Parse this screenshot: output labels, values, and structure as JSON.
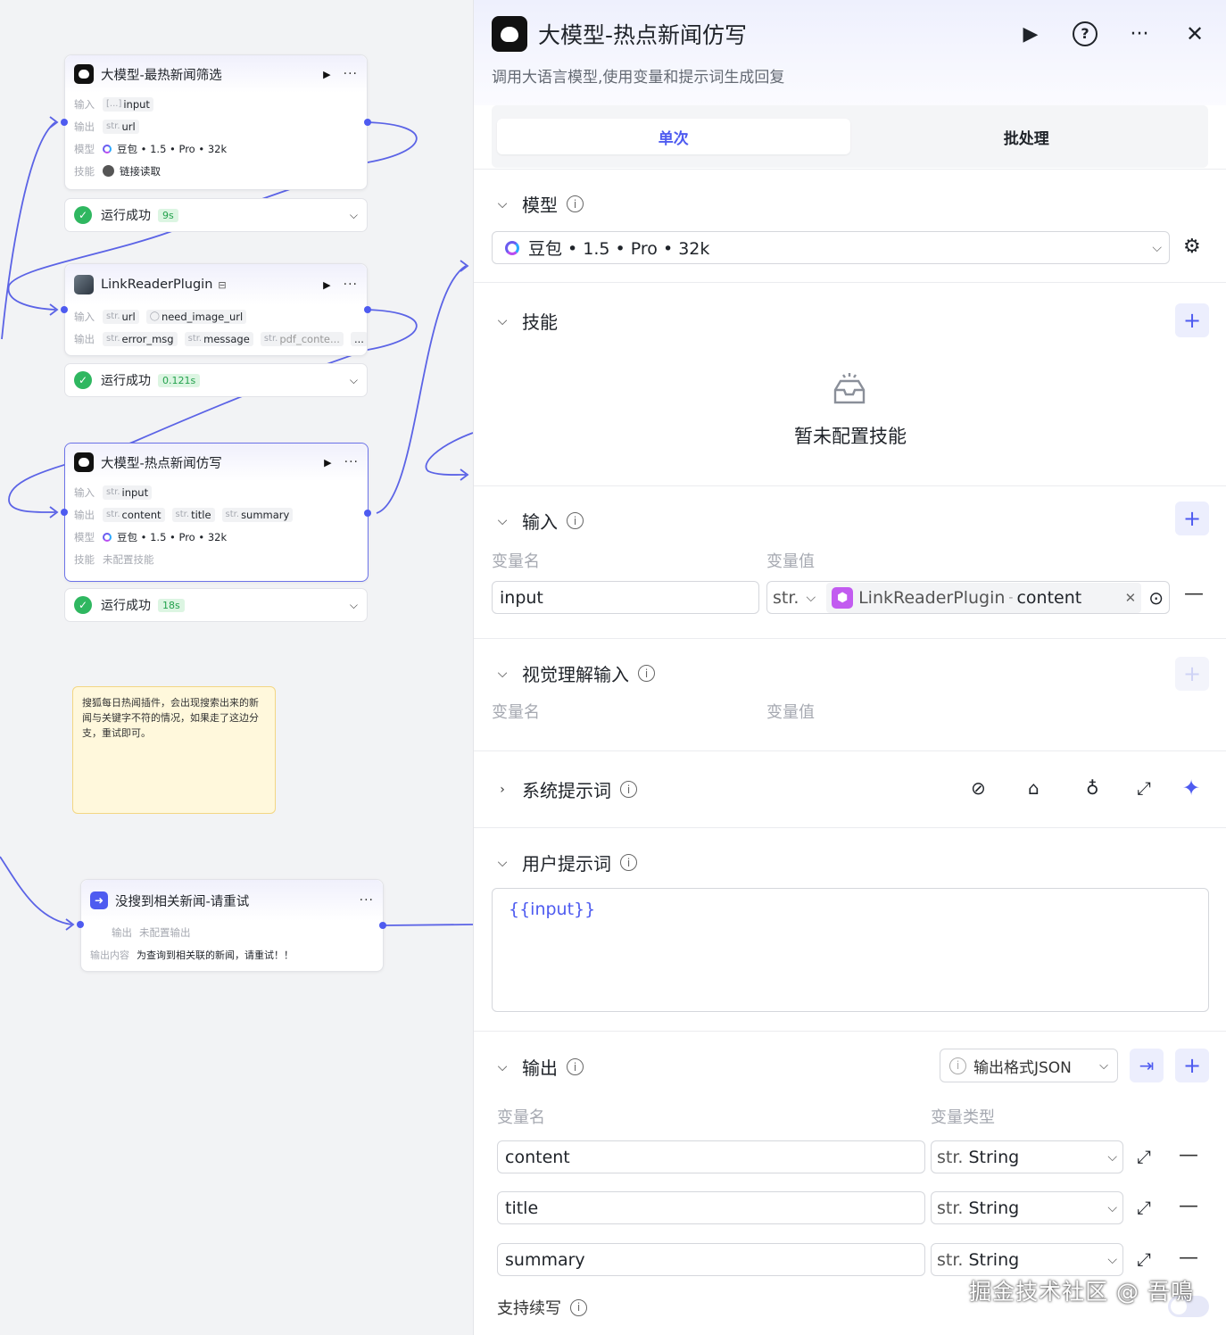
{
  "canvas": {
    "nodes": [
      {
        "title": "大模型-最热新闻筛选",
        "rows": [
          {
            "key": "输入",
            "tags": [
              {
                "type": "[...]",
                "name": "input"
              }
            ]
          },
          {
            "key": "输出",
            "tags": [
              {
                "type": "str.",
                "name": "url"
              }
            ]
          },
          {
            "key": "模型",
            "text": "豆包 • 1.5 • Pro • 32k"
          },
          {
            "key": "技能",
            "text": "链接读取"
          }
        ],
        "status": "运行成功",
        "time": "9s"
      },
      {
        "title": "LinkReaderPlugin",
        "rows": [
          {
            "key": "输入",
            "tags": [
              {
                "type": "str.",
                "name": "url"
              },
              {
                "type": "◯",
                "name": "need_image_url"
              }
            ]
          },
          {
            "key": "输出",
            "tags": [
              {
                "type": "str.",
                "name": "error_msg"
              },
              {
                "type": "str.",
                "name": "message"
              },
              {
                "type": "str.",
                "name": "pdf_conte..."
              }
            ],
            "more": "..."
          }
        ],
        "status": "运行成功",
        "time": "0.121s"
      },
      {
        "title": "大模型-热点新闻仿写",
        "rows": [
          {
            "key": "输入",
            "tags": [
              {
                "type": "str.",
                "name": "input"
              }
            ]
          },
          {
            "key": "输出",
            "tags": [
              {
                "type": "str.",
                "name": "content"
              },
              {
                "type": "str.",
                "name": "title"
              },
              {
                "type": "str.",
                "name": "summary"
              }
            ]
          },
          {
            "key": "模型",
            "text": "豆包 • 1.5 • Pro • 32k"
          },
          {
            "key": "技能",
            "text": "未配置技能"
          }
        ],
        "status": "运行成功",
        "time": "18s"
      },
      {
        "title": "没搜到相关新闻-请重试",
        "output_key": "输出",
        "output_val": "未配置输出",
        "content_key": "输出内容",
        "content_val": "为查询到相关联的新闻，请重试！！"
      }
    ],
    "note": "搜狐每日热闻插件，会出现搜索出来的新闻与关键字不符的情况，如果走了这边分支，重试即可。"
  },
  "panel": {
    "title": "大模型-热点新闻仿写",
    "description": "调用大语言模型,使用变量和提示词生成回复",
    "tabs": [
      "单次",
      "批处理"
    ],
    "model": {
      "label": "模型",
      "value": "豆包 • 1.5 • Pro • 32k"
    },
    "skills": {
      "label": "技能",
      "empty": "暂未配置技能"
    },
    "input": {
      "label": "输入",
      "col_name": "变量名",
      "col_value": "变量值",
      "name": "input",
      "type": "str.",
      "ref_node": "LinkReaderPlugin",
      "ref_sep": "-",
      "ref_field": "content"
    },
    "vision": {
      "label": "视觉理解输入",
      "col_name": "变量名",
      "col_value": "变量值"
    },
    "system_prompt": {
      "label": "系统提示词"
    },
    "user_prompt": {
      "label": "用户提示词",
      "content": "{{input}}"
    },
    "output": {
      "label": "输出",
      "format": "输出格式JSON",
      "col_name": "变量名",
      "col_type": "变量类型",
      "vars": [
        {
          "name": "content",
          "type": "String"
        },
        {
          "name": "title",
          "type": "String"
        },
        {
          "name": "summary",
          "type": "String"
        }
      ],
      "type_prefix": "str."
    },
    "continue_label": "支持续写",
    "watermark": "掘金技术社区 @ 吾鳴"
  },
  "colors": {
    "accent": "#4e5bf0",
    "success": "#2fb760",
    "note_bg": "#fff8dc"
  }
}
